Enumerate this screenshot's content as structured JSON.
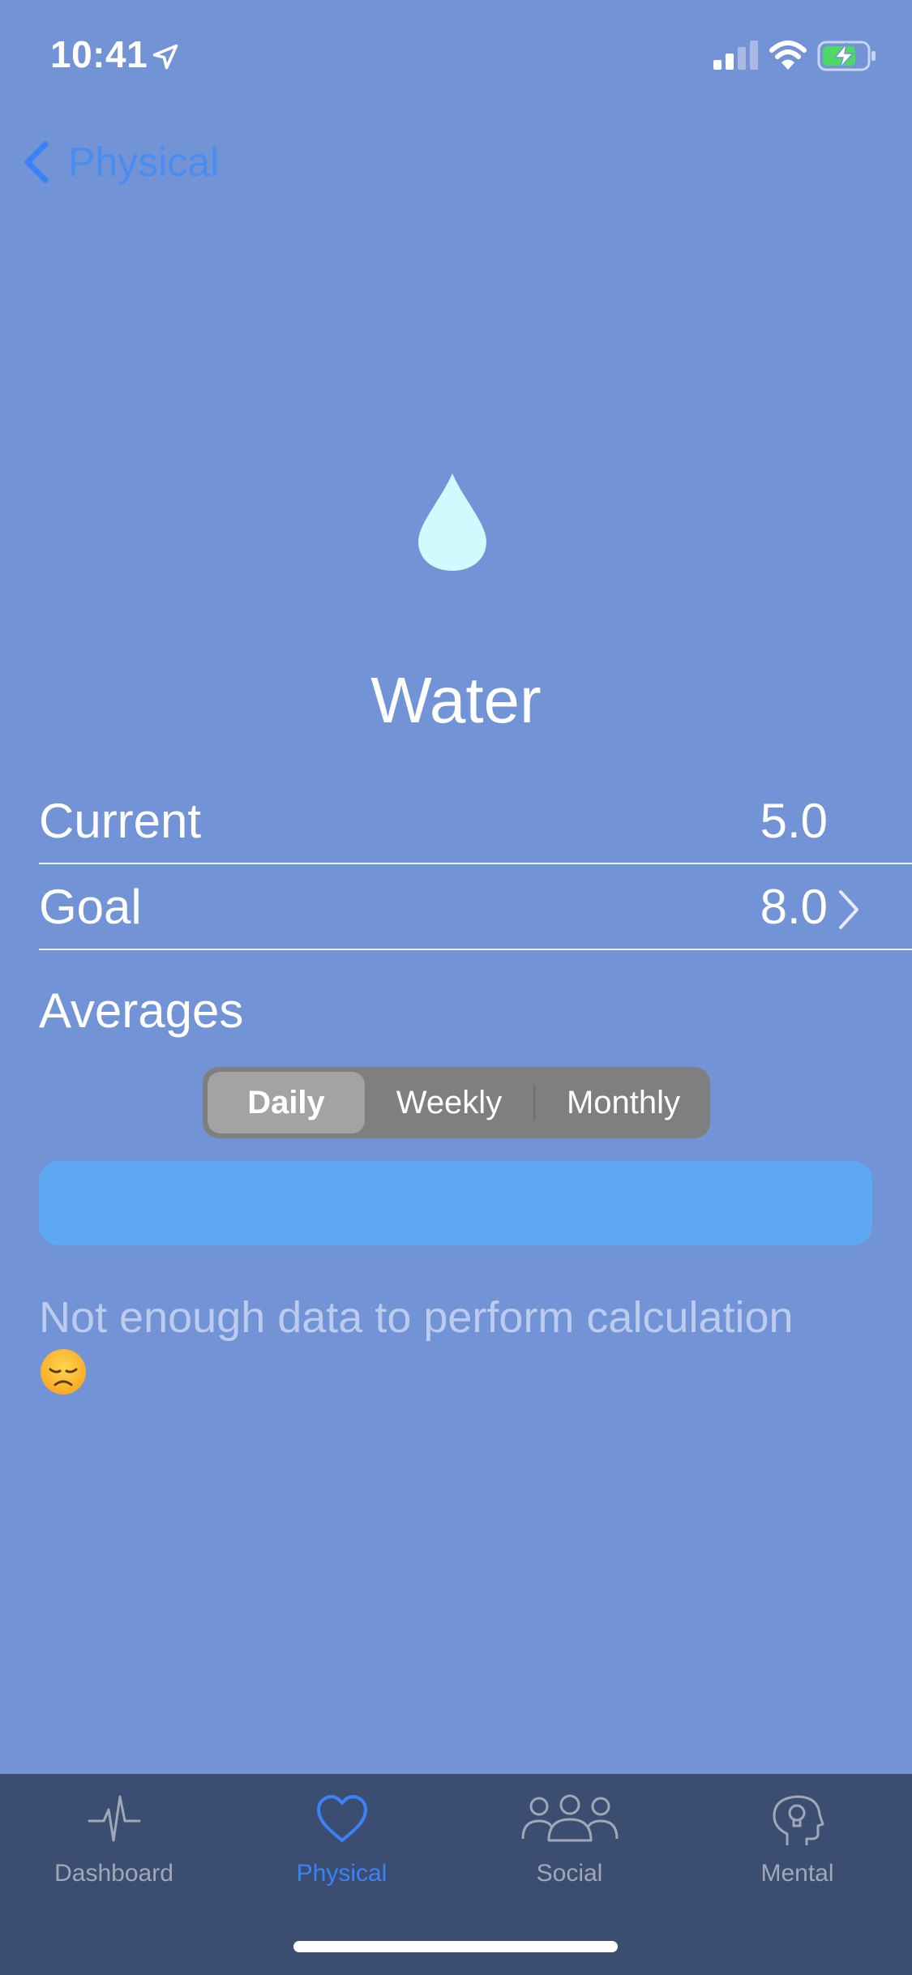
{
  "status_bar": {
    "time": "10:41"
  },
  "nav": {
    "back_label": "Physical"
  },
  "metric": {
    "title": "Water",
    "current_label": "Current",
    "current_value": "5.0",
    "goal_label": "Goal",
    "goal_value": "8.0"
  },
  "averages": {
    "title": "Averages",
    "segments": [
      "Daily",
      "Weekly",
      "Monthly"
    ],
    "selected": "Daily",
    "message": "Not enough data to perform calculation"
  },
  "tab_bar": {
    "tabs": [
      {
        "label": "Dashboard",
        "icon": "heartbeat-icon"
      },
      {
        "label": "Physical",
        "icon": "heart-icon"
      },
      {
        "label": "Social",
        "icon": "people-icon"
      },
      {
        "label": "Mental",
        "icon": "head-lightbulb-icon"
      }
    ],
    "active": "Physical"
  },
  "colors": {
    "background": "#7293d6",
    "accent": "#3b82f6",
    "drop": "#cffafe",
    "bar": "#5ea7f3",
    "tab_bar": "#3b4e71"
  }
}
